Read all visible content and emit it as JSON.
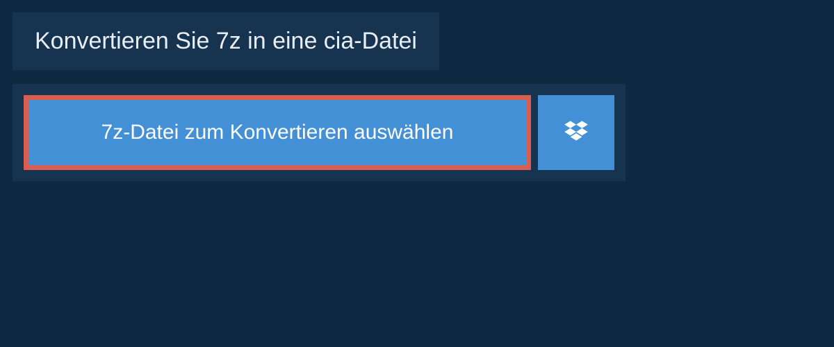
{
  "header": {
    "title": "Konvertieren Sie 7z in eine cia-Datei"
  },
  "converter": {
    "selectButtonLabel": "7z-Datei zum Konvertieren auswählen"
  }
}
